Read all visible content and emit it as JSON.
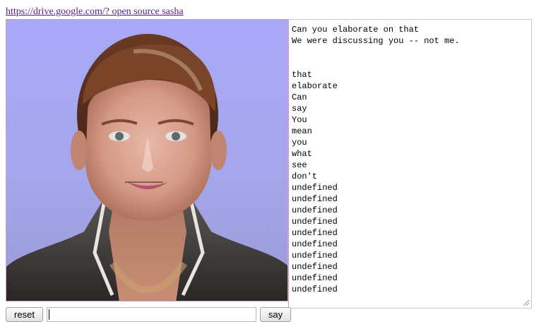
{
  "header": {
    "link_text": "https://drive.google.com/? open source sasha"
  },
  "transcript": {
    "lines": [
      "Can you elaborate on that",
      "We were discussing you -- not me.",
      "",
      "",
      "that",
      "elaborate",
      "Can",
      "say",
      "You",
      "mean",
      "you",
      "what",
      "see",
      "don't",
      "undefined",
      "undefined",
      "undefined",
      "undefined",
      "undefined",
      "undefined",
      "undefined",
      "undefined",
      "undefined",
      "undefined"
    ]
  },
  "controls": {
    "reset_label": "reset",
    "say_label": "say",
    "input_value": "",
    "input_placeholder": ""
  },
  "colors": {
    "background_sky": "#a8a8f8",
    "link": "#551a8b"
  },
  "icons": {
    "resize": "resize-grip-icon"
  }
}
